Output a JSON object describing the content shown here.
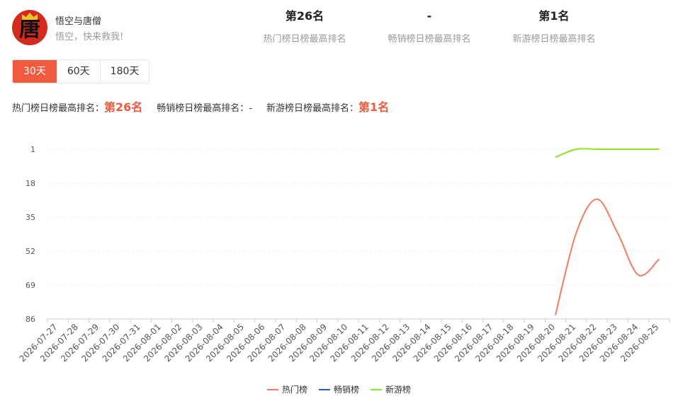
{
  "game": {
    "title": "悟空与唐僧",
    "subtitle": "悟空，快来救我!",
    "avatar_char": "唐"
  },
  "stats": [
    {
      "value": "第26名",
      "label": "热门榜日榜最高排名"
    },
    {
      "value": "-",
      "label": "畅销榜日榜最高排名"
    },
    {
      "value": "第1名",
      "label": "新游榜日榜最高排名"
    }
  ],
  "tabs": [
    {
      "label": "30天",
      "active": true
    },
    {
      "label": "60天",
      "active": false
    },
    {
      "label": "180天",
      "active": false
    }
  ],
  "summary": {
    "hot_label": "热门榜日榜最高排名：",
    "hot_value": "第26名",
    "sales_label": "畅销榜日榜最高排名：",
    "sales_value": "-",
    "new_label": "新游榜日榜最高排名：",
    "new_value": "第1名"
  },
  "colors": {
    "accent": "#f05a3e",
    "hot": "#f07b62",
    "sales": "#2e5bb8",
    "new": "#8fe31e"
  },
  "chart_data": {
    "type": "line",
    "x": [
      "2026-07-27",
      "2026-07-28",
      "2026-07-29",
      "2026-07-30",
      "2026-07-31",
      "2026-08-01",
      "2026-08-02",
      "2026-08-03",
      "2026-08-04",
      "2026-08-05",
      "2026-08-06",
      "2026-08-07",
      "2026-08-08",
      "2026-08-09",
      "2026-08-10",
      "2026-08-11",
      "2026-08-12",
      "2026-08-13",
      "2026-08-14",
      "2026-08-15",
      "2026-08-16",
      "2026-08-17",
      "2026-08-18",
      "2026-08-19",
      "2026-08-20",
      "2026-08-21",
      "2026-08-22",
      "2026-08-23",
      "2026-08-24",
      "2026-08-25"
    ],
    "y_ticks": [
      1,
      18,
      35,
      52,
      69,
      86
    ],
    "ylim": [
      1,
      86
    ],
    "y_inverted": true,
    "grid": true,
    "legend_position": "bottom",
    "series": [
      {
        "name": "热门榜",
        "color": "#f07b62",
        "values": [
          null,
          null,
          null,
          null,
          null,
          null,
          null,
          null,
          null,
          null,
          null,
          null,
          null,
          null,
          null,
          null,
          null,
          null,
          null,
          null,
          null,
          null,
          null,
          null,
          84,
          43,
          26,
          43,
          64,
          56
        ]
      },
      {
        "name": "畅销榜",
        "color": "#2e5bb8",
        "values": []
      },
      {
        "name": "新游榜",
        "color": "#8fe31e",
        "values": [
          null,
          null,
          null,
          null,
          null,
          null,
          null,
          null,
          null,
          null,
          null,
          null,
          null,
          null,
          null,
          null,
          null,
          null,
          null,
          null,
          null,
          null,
          null,
          null,
          5,
          1,
          1,
          1,
          1,
          1
        ]
      }
    ]
  }
}
